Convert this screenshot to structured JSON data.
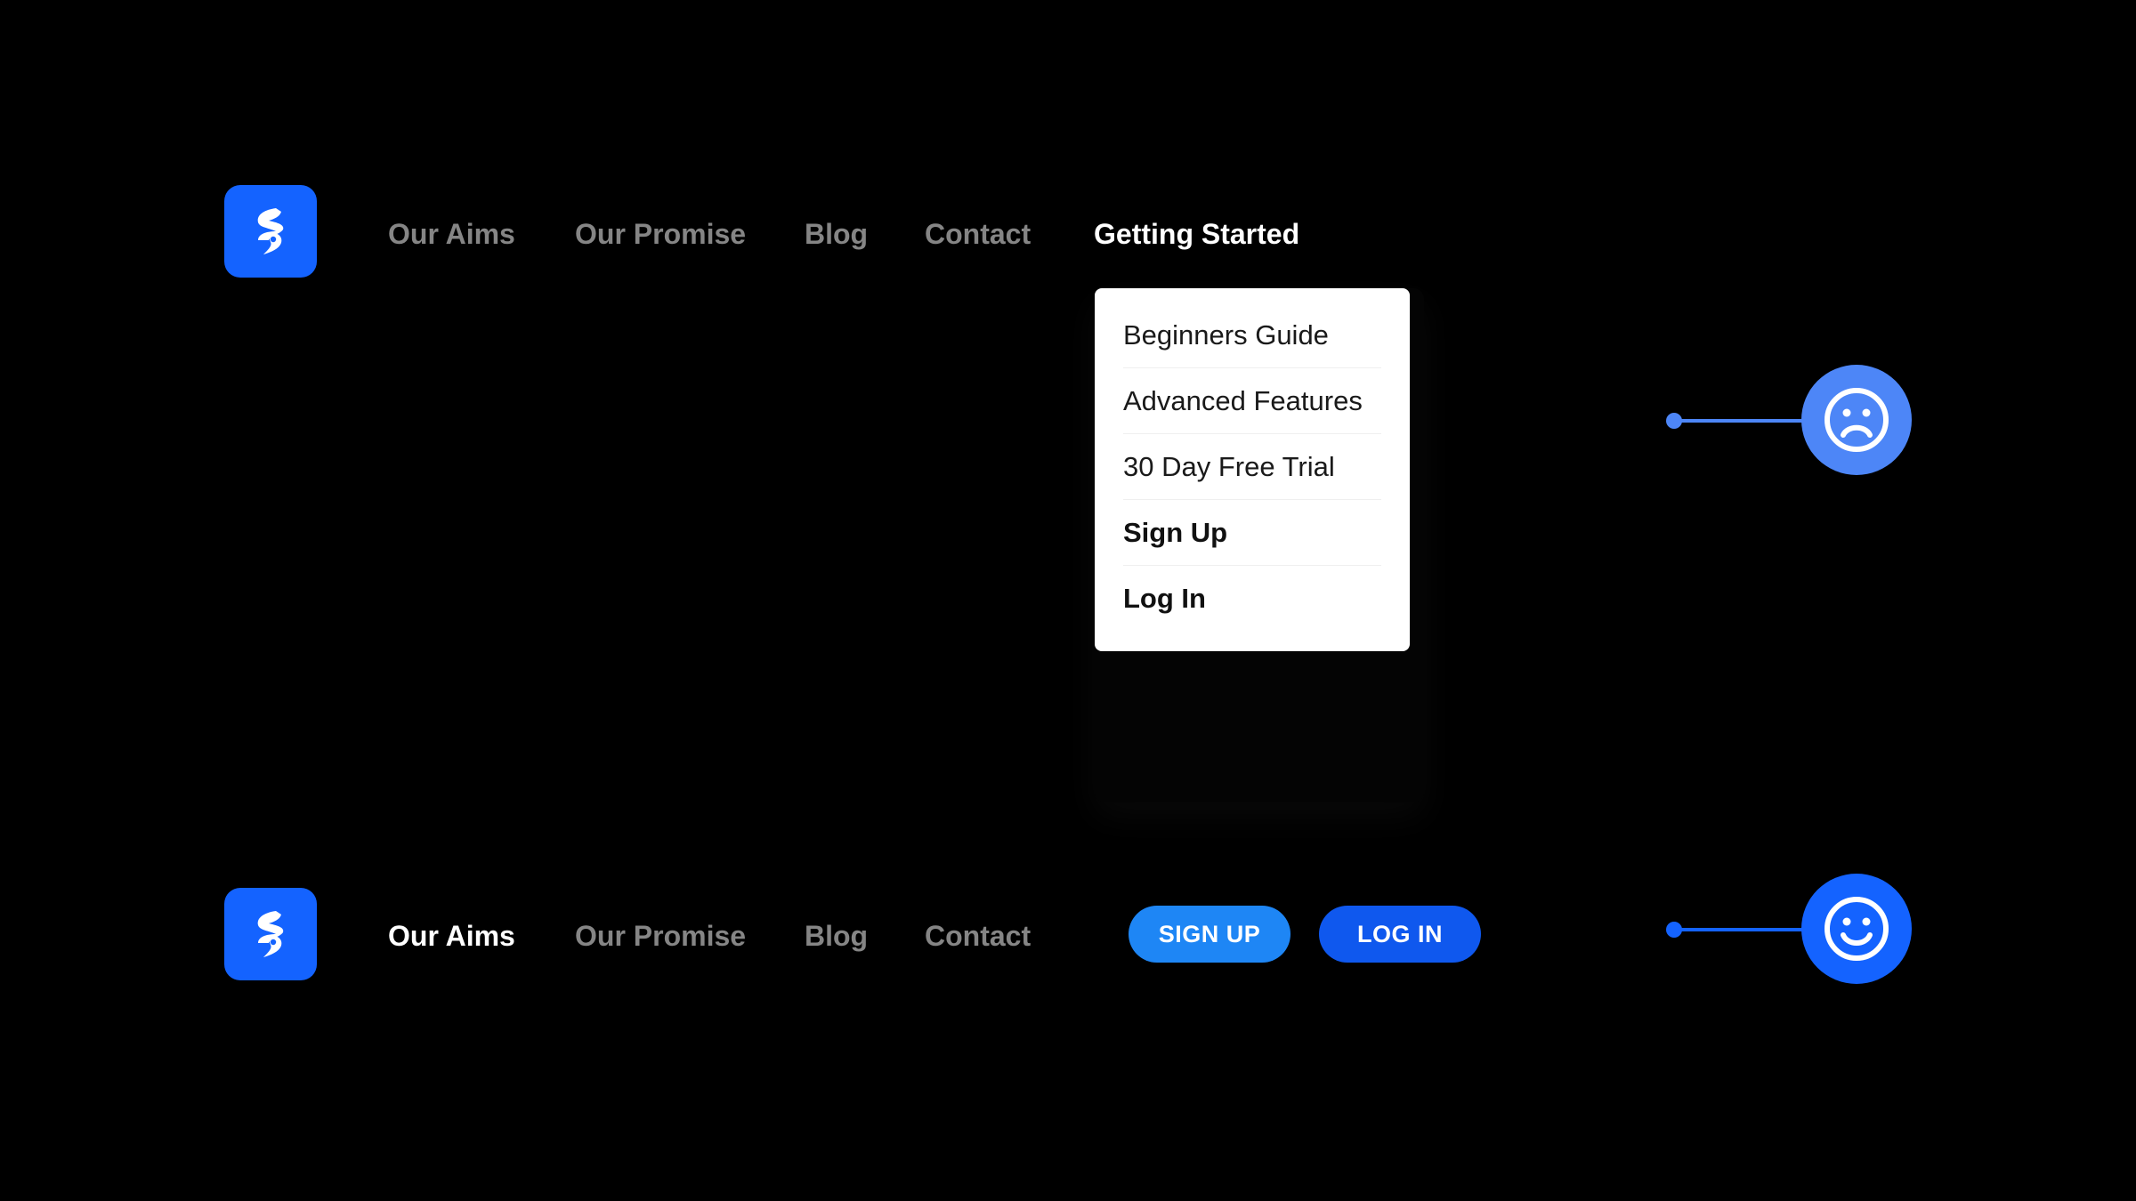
{
  "colors": {
    "background": "#000000",
    "brand_blue": "#1463ff",
    "nav_inactive": "#858585",
    "nav_active": "#ffffff",
    "signup_button": "#1e86f5",
    "login_button": "#0f58ee",
    "sad_indicator": "#4d86f7",
    "happy_indicator": "#1463ff"
  },
  "top_header": {
    "logo_icon": "brand-s-logo-icon",
    "nav": [
      {
        "label": "Our Aims",
        "active": false
      },
      {
        "label": "Our Promise",
        "active": false
      },
      {
        "label": "Blog",
        "active": false
      },
      {
        "label": "Contact",
        "active": false
      },
      {
        "label": "Getting Started",
        "active": true
      }
    ],
    "dropdown": [
      {
        "label": "Beginners Guide",
        "bold": false
      },
      {
        "label": "Advanced Features",
        "bold": false
      },
      {
        "label": "30 Day Free Trial",
        "bold": false
      },
      {
        "label": "Sign Up",
        "bold": true
      },
      {
        "label": "Log In",
        "bold": true
      }
    ],
    "indicator_icon": "sad-face-icon"
  },
  "bottom_header": {
    "logo_icon": "brand-s-logo-icon",
    "nav": [
      {
        "label": "Our Aims",
        "active": true
      },
      {
        "label": "Our Promise",
        "active": false
      },
      {
        "label": "Blog",
        "active": false
      },
      {
        "label": "Contact",
        "active": false
      }
    ],
    "signup_label": "SIGN UP",
    "login_label": "LOG IN",
    "indicator_icon": "happy-face-icon"
  }
}
